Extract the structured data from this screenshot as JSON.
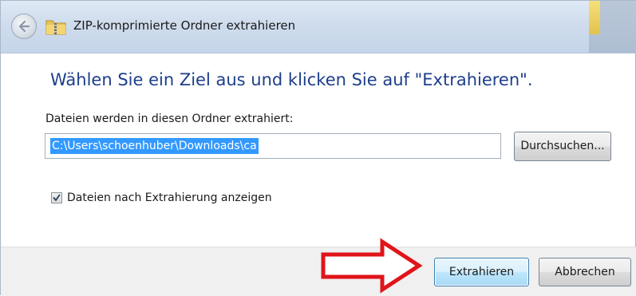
{
  "window": {
    "title": "ZIP-komprimierte Ordner extrahieren"
  },
  "content": {
    "heading": "Wählen Sie ein Ziel aus und klicken Sie auf \"Extrahieren\".",
    "field_label": "Dateien werden in diesen Ordner extrahiert:",
    "path_value": "C:\\Users\\schoenhuber\\Downloads\\ca",
    "browse_label": "Durchsuchen...",
    "checkbox_label": "Dateien nach Extrahierung anzeigen",
    "checkbox_checked": true
  },
  "footer": {
    "extract_label": "Extrahieren",
    "cancel_label": "Abbrechen"
  },
  "icons": {
    "back": "back-arrow-icon",
    "folder": "zip-folder-icon",
    "checkmark": "checkmark-icon",
    "annotation": "red-arrow-icon"
  },
  "colors": {
    "heading": "#1e3e8c",
    "selection": "#3399ff",
    "annotation_arrow": "#e0141a"
  }
}
